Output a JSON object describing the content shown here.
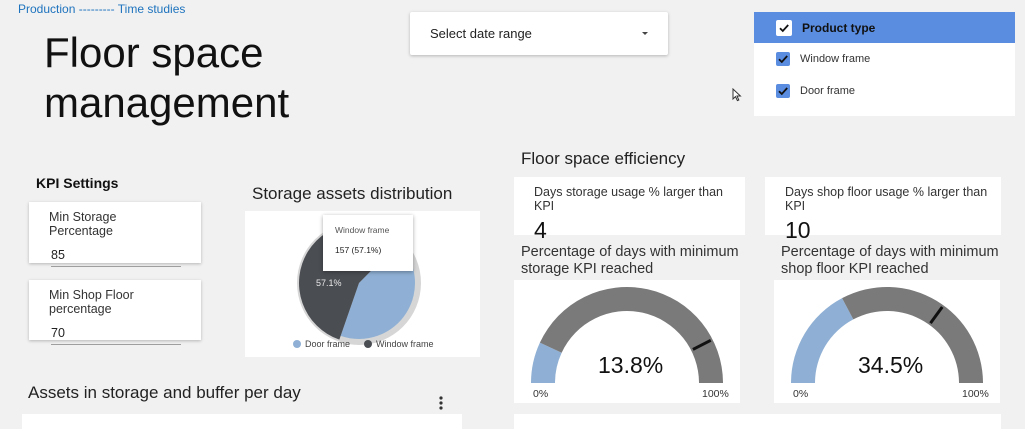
{
  "breadcrumb": {
    "parent": "Production",
    "separator": " --------- ",
    "current": "Time studies"
  },
  "page_title": {
    "line1": "Floor space",
    "line2": "management"
  },
  "date_range": {
    "label": "Select date range"
  },
  "product_filter": {
    "header": "Product type",
    "options": [
      {
        "label": "Window frame",
        "checked": true
      },
      {
        "label": "Door frame",
        "checked": true
      }
    ]
  },
  "kpi_settings": {
    "title": "KPI Settings",
    "min_storage": {
      "label": "Min Storage Percentage",
      "value": "85"
    },
    "min_shop_floor": {
      "label": "Min Shop Floor percentage",
      "value": "70"
    }
  },
  "storage_distribution": {
    "title": "Storage assets distribution",
    "tooltip": {
      "label": "Window frame",
      "value": "157 (57.1%)"
    },
    "slice_label": "57.1%",
    "chart_data": {
      "type": "pie",
      "slices": [
        {
          "name": "Window frame",
          "value": 57.1,
          "color": "#4a4d52"
        },
        {
          "name": "Door frame",
          "value": 42.9,
          "color": "#8fb0d4"
        }
      ]
    },
    "legend": [
      "Door frame",
      "Window frame"
    ]
  },
  "floor_efficiency": {
    "title": "Floor space efficiency",
    "storage_days": {
      "label": "Days storage usage % larger than KPI",
      "value": "4"
    },
    "shop_days": {
      "label": "Days shop floor usage % larger than KPI",
      "value": "10"
    },
    "storage_gauge": {
      "title_line1": "Percentage of days with minimum",
      "title_line2": "storage KPI reached",
      "value": 13.8,
      "value_text": "13.8%",
      "min": "0%",
      "max": "100%",
      "target": 85
    },
    "shop_gauge": {
      "title_line1": "Percentage of days with minimum",
      "title_line2": "shop floor KPI reached",
      "value": 34.5,
      "value_text": "34.5%",
      "min": "0%",
      "max": "100%",
      "target": 70
    }
  },
  "assets_per_day": {
    "title": "Assets in storage and buffer per day"
  },
  "colors": {
    "accent": "#5a8de0",
    "gauge_fill": "#8fb0d4",
    "gauge_track": "#7a7a7a",
    "pie_dark": "#4a4d52",
    "pie_light": "#8fb0d4"
  }
}
